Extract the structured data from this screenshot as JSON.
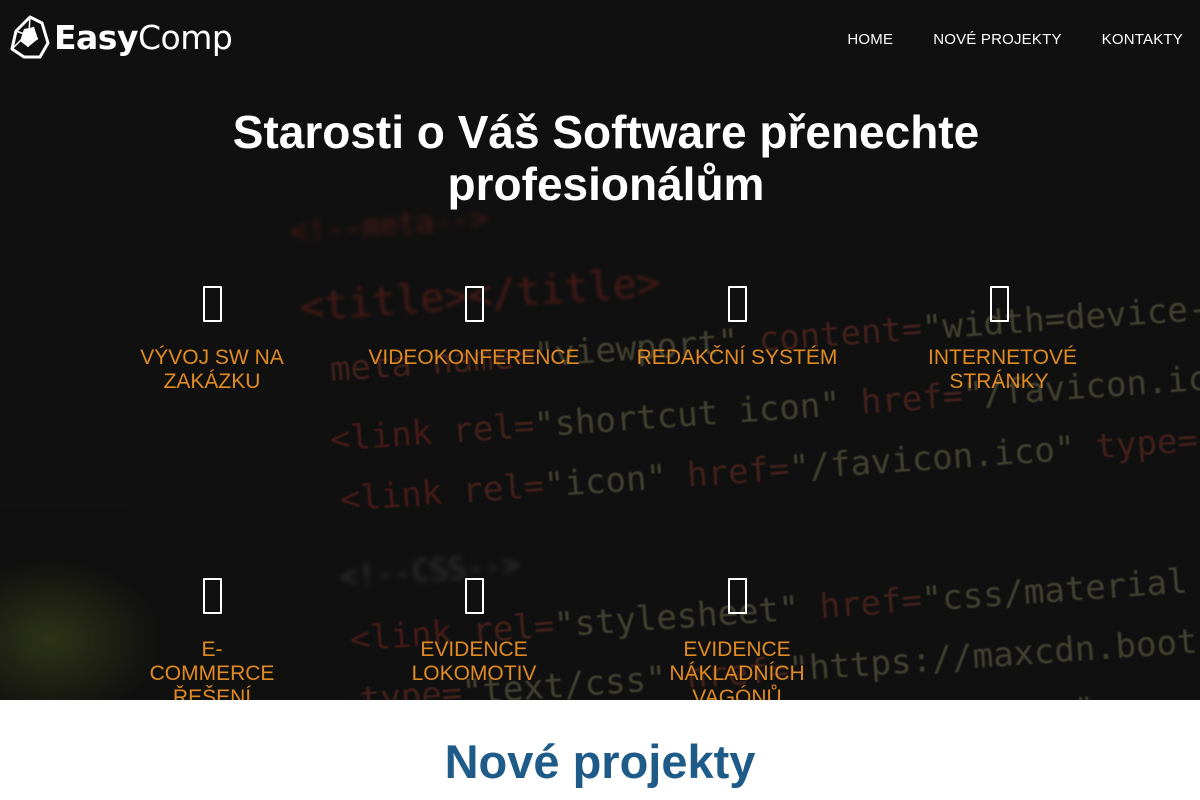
{
  "header": {
    "logo": {
      "easy": "Easy",
      "comp": "Comp"
    },
    "nav": [
      {
        "label": "HOME"
      },
      {
        "label": "NOVÉ PROJEKTY"
      },
      {
        "label": "KONTAKTY"
      }
    ]
  },
  "hero": {
    "headline": "Starosti o Váš Software přenechte profesionálům",
    "services": [
      {
        "label": "VÝVOJ SW NA ZAKÁZKU",
        "icon": "service-icon"
      },
      {
        "label": "VIDEOKONFERENCE",
        "icon": "service-icon"
      },
      {
        "label": "REDAKČNÍ SYSTÉM",
        "icon": "service-icon"
      },
      {
        "label": "INTERNETOVÉ STRÁNKY",
        "icon": "service-icon"
      },
      {
        "label": "E-COMMERCE ŘEŠENÍ",
        "icon": "service-icon"
      },
      {
        "label": "EVIDENCE LOKOMOTIV",
        "icon": "service-icon"
      },
      {
        "label": "EVIDENCE NÁKLADNÍCH VAGÓNŮ",
        "icon": "service-icon"
      }
    ]
  },
  "sections": {
    "new_projects_title": "Nové projekty"
  },
  "colors": {
    "accent": "#e08a22",
    "section_title": "#1e5b88",
    "hero_bg": "#151515"
  }
}
